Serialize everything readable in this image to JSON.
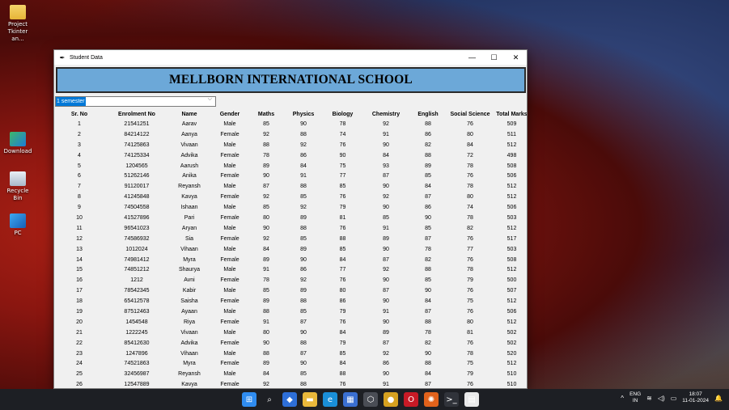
{
  "desktop": {
    "icons": [
      {
        "label": "Project Tkinter an...",
        "icon": "folder-icon"
      },
      {
        "label": "Download",
        "icon": "download-shortcut-icon"
      },
      {
        "label": "Recycle Bin",
        "icon": "recycle-bin-icon"
      },
      {
        "label": "PC",
        "icon": "pc-icon"
      }
    ]
  },
  "window": {
    "title": "Student Data",
    "minimize": "—",
    "maximize": "☐",
    "close": "✕"
  },
  "banner": "MELLBORN INTERNATIONAL SCHOOL",
  "semester_select": {
    "value": "1 semester",
    "arrow": "⌵"
  },
  "table": {
    "headers": [
      "Sr. No",
      "Enrolment No",
      "Name",
      "Gender",
      "Maths",
      "Physics",
      "Biology",
      "Chemistry",
      "English",
      "Social Science",
      "Total Marks"
    ],
    "rows": [
      [
        "1",
        "21541251",
        "Aarav",
        "Male",
        "85",
        "90",
        "78",
        "92",
        "88",
        "76",
        "509"
      ],
      [
        "2",
        "84214122",
        "Aanya",
        "Female",
        "92",
        "88",
        "74",
        "91",
        "86",
        "80",
        "511"
      ],
      [
        "3",
        "74125863",
        "Vivaan",
        "Male",
        "88",
        "92",
        "76",
        "90",
        "82",
        "84",
        "512"
      ],
      [
        "4",
        "74125334",
        "Advika",
        "Female",
        "78",
        "86",
        "90",
        "84",
        "88",
        "72",
        "498"
      ],
      [
        "5",
        "1204565",
        "Aarush",
        "Male",
        "89",
        "84",
        "75",
        "93",
        "89",
        "78",
        "508"
      ],
      [
        "6",
        "51262146",
        "Anika",
        "Female",
        "90",
        "91",
        "77",
        "87",
        "85",
        "76",
        "506"
      ],
      [
        "7",
        "91120017",
        "Reyansh",
        "Male",
        "87",
        "88",
        "85",
        "90",
        "84",
        "78",
        "512"
      ],
      [
        "8",
        "41245848",
        "Kavya",
        "Female",
        "92",
        "85",
        "76",
        "92",
        "87",
        "80",
        "512"
      ],
      [
        "9",
        "74504558",
        "Ishaan",
        "Male",
        "85",
        "92",
        "79",
        "90",
        "86",
        "74",
        "506"
      ],
      [
        "10",
        "41527896",
        "Pari",
        "Female",
        "80",
        "89",
        "81",
        "85",
        "90",
        "78",
        "503"
      ],
      [
        "11",
        "96541023",
        "Aryan",
        "Male",
        "90",
        "88",
        "76",
        "91",
        "85",
        "82",
        "512"
      ],
      [
        "12",
        "74586932",
        "Sia",
        "Female",
        "92",
        "85",
        "88",
        "89",
        "87",
        "76",
        "517"
      ],
      [
        "13",
        "1012024",
        "Vihaan",
        "Male",
        "84",
        "89",
        "85",
        "90",
        "78",
        "77",
        "503"
      ],
      [
        "14",
        "74981412",
        "Myra",
        "Female",
        "89",
        "90",
        "84",
        "87",
        "82",
        "76",
        "508"
      ],
      [
        "15",
        "74851212",
        "Shaurya",
        "Male",
        "91",
        "86",
        "77",
        "92",
        "88",
        "78",
        "512"
      ],
      [
        "16",
        "1212",
        "Avni",
        "Female",
        "78",
        "92",
        "76",
        "90",
        "85",
        "79",
        "500"
      ],
      [
        "17",
        "78542345",
        "Kabir",
        "Male",
        "85",
        "89",
        "80",
        "87",
        "90",
        "76",
        "507"
      ],
      [
        "18",
        "65412578",
        "Saisha",
        "Female",
        "89",
        "88",
        "86",
        "90",
        "84",
        "75",
        "512"
      ],
      [
        "19",
        "87512463",
        "Ayaan",
        "Male",
        "88",
        "85",
        "79",
        "91",
        "87",
        "76",
        "506"
      ],
      [
        "20",
        "1454548",
        "Riya",
        "Female",
        "91",
        "87",
        "76",
        "90",
        "88",
        "80",
        "512"
      ],
      [
        "21",
        "1222245",
        "Vivaan",
        "Male",
        "80",
        "90",
        "84",
        "89",
        "78",
        "81",
        "502"
      ],
      [
        "22",
        "85412630",
        "Advika",
        "Female",
        "90",
        "88",
        "79",
        "87",
        "82",
        "76",
        "502"
      ],
      [
        "23",
        "1247896",
        "Vihaan",
        "Male",
        "88",
        "87",
        "85",
        "92",
        "90",
        "78",
        "520"
      ],
      [
        "24",
        "74521863",
        "Myra",
        "Female",
        "89",
        "90",
        "84",
        "86",
        "88",
        "75",
        "512"
      ],
      [
        "25",
        "32456987",
        "Reyansh",
        "Male",
        "84",
        "85",
        "88",
        "90",
        "84",
        "79",
        "510"
      ],
      [
        "26",
        "12547889",
        "Kavya",
        "Female",
        "92",
        "88",
        "76",
        "91",
        "87",
        "76",
        "510"
      ]
    ]
  },
  "taskbar": {
    "apps": [
      {
        "name": "start-button",
        "glyph": "⊞",
        "color": "#2f8cf0"
      },
      {
        "name": "search-button",
        "glyph": "⌕",
        "color": "#1d1f24"
      },
      {
        "name": "widgets-icon",
        "glyph": "◆",
        "color": "#2e6fd8"
      },
      {
        "name": "file-explorer-icon",
        "glyph": "▬",
        "color": "#e9b83b"
      },
      {
        "name": "edge-icon",
        "glyph": "e",
        "color": "#1a8fd8"
      },
      {
        "name": "store-icon",
        "glyph": "▦",
        "color": "#3a6fd1"
      },
      {
        "name": "settings-icon",
        "glyph": "⬡",
        "color": "#4a4d55"
      },
      {
        "name": "chrome-icon",
        "glyph": "●",
        "color": "#d6a120"
      },
      {
        "name": "opera-icon",
        "glyph": "O",
        "color": "#c81a26"
      },
      {
        "name": "firefox-icon",
        "glyph": "✺",
        "color": "#e2621b"
      },
      {
        "name": "terminal-icon",
        "glyph": ">_",
        "color": "#30333a"
      },
      {
        "name": "notepad-icon",
        "glyph": "▤",
        "color": "#e9e9ea"
      }
    ],
    "chevron": "^",
    "lang_top": "ENG",
    "lang_bottom": "IN",
    "time": "18:07",
    "date": "11-01-2024"
  }
}
